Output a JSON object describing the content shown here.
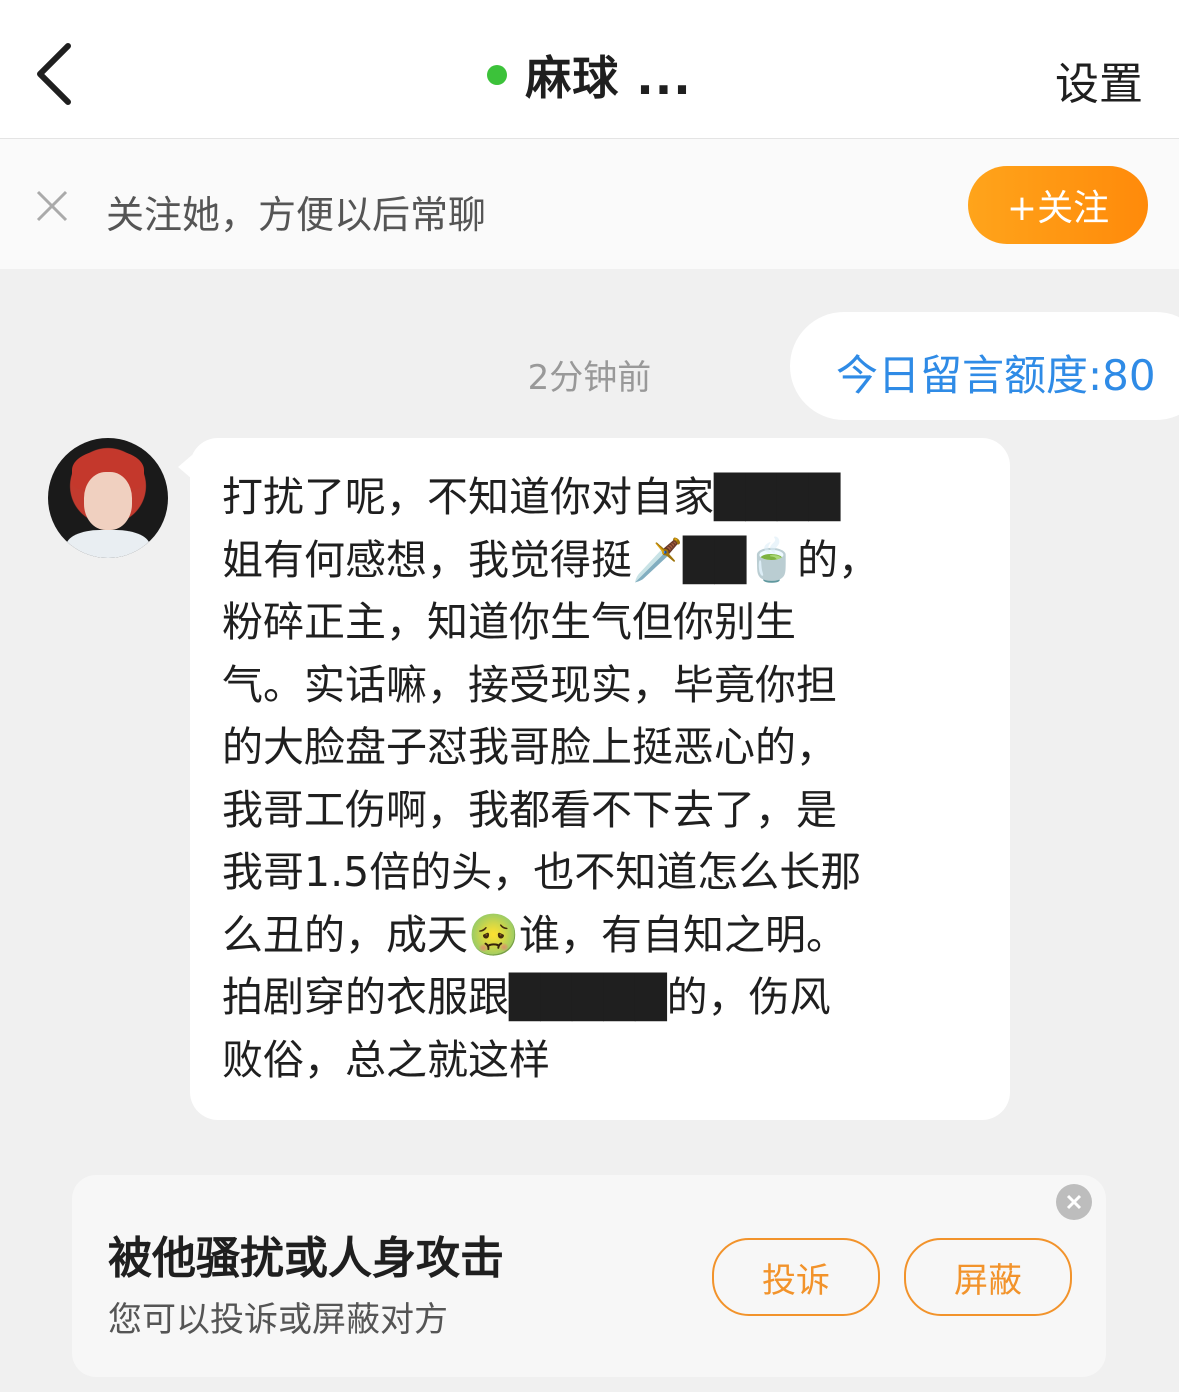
{
  "header": {
    "title": "麻球 ...",
    "settings_label": "设置",
    "online_color": "#3cc23a"
  },
  "follow_bar": {
    "prompt": "关注她，方便以后常聊",
    "follow_button": "+关注",
    "button_colors": [
      "#ffa41b",
      "#ff8a0a"
    ]
  },
  "chat": {
    "quota_label": "今日留言额度:80",
    "quota_color": "#2f8be6",
    "timestamp": "2分钟前",
    "message": {
      "text": "打扰了呢，不知道你对自家████\n姐有何感想，我觉得挺🗡️██🍵的，\n粉碎正主，知道你生气但你别生\n气。实话嘛，接受现实，毕竟你担\n的大脸盘子怼我哥脸上挺恶心的，\n我哥工伤啊，我都看不下去了，是\n我哥1.5倍的头，也不知道怎么长那\n么丑的，成天🤢谁，有自知之明。\n拍剧穿的衣服跟█████的，伤风\n败俗，总之就这样"
    }
  },
  "report": {
    "title": "被他骚扰或人身攻击",
    "subtitle": "您可以投诉或屏蔽对方",
    "complain_label": "投诉",
    "block_label": "屏蔽",
    "accent": "#f2932b"
  }
}
